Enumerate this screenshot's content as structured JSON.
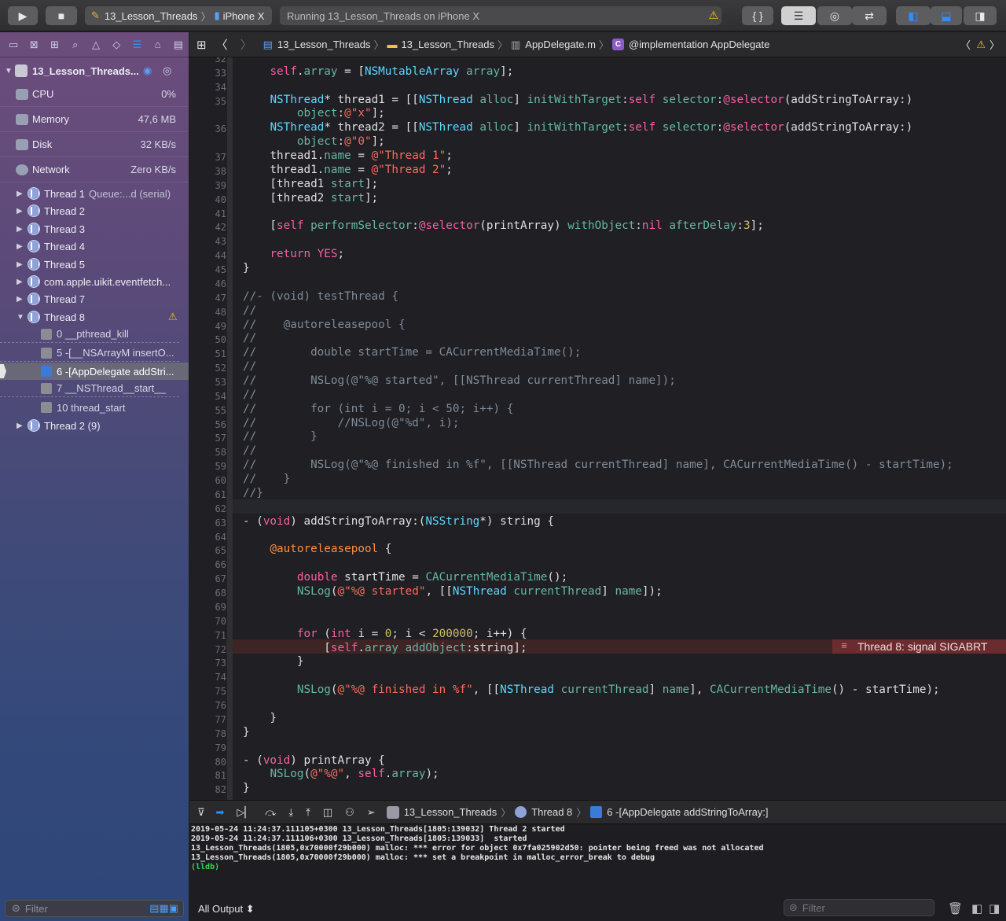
{
  "toolbar": {
    "run_icon": "play-icon",
    "stop_icon": "stop-icon",
    "scheme": "13_Lesson_Threads",
    "device": "iPhone X",
    "status": "Running 13_Lesson_Threads on iPhone X",
    "warn_glyph": "⚠"
  },
  "sidebar": {
    "process": "13_Lesson_Threads...",
    "gauges": [
      {
        "label": "CPU",
        "value": "0%"
      },
      {
        "label": "Memory",
        "value": "47,6 MB"
      },
      {
        "label": "Disk",
        "value": "32 KB/s"
      },
      {
        "label": "Network",
        "value": "Zero KB/s"
      }
    ],
    "threads": [
      {
        "name": "Thread 1",
        "detail": "Queue:...d (serial)"
      },
      {
        "name": "Thread 2",
        "detail": ""
      },
      {
        "name": "Thread 3",
        "detail": ""
      },
      {
        "name": "Thread 4",
        "detail": ""
      },
      {
        "name": "Thread 5",
        "detail": ""
      },
      {
        "name": "com.apple.uikit.eventfetch...",
        "detail": ""
      },
      {
        "name": "Thread 7",
        "detail": ""
      },
      {
        "name": "Thread 8",
        "detail": ""
      }
    ],
    "frames": [
      "0 __pthread_kill",
      "5 -[__NSArrayM insertO...",
      "6 -[AppDelegate addStri...",
      "7 __NSThread__start__",
      "10 thread_start"
    ],
    "last_thread": "Thread 2 (9)",
    "filter_placeholder": "Filter"
  },
  "jumpbar": {
    "project": "13_Lesson_Threads",
    "folder": "13_Lesson_Threads",
    "file": "AppDelegate.m",
    "symbol": "@implementation AppDelegate"
  },
  "code": {
    "first_line": 32,
    "error_badge": "Thread 8: signal SIGABRT"
  },
  "debug": {
    "project": "13_Lesson_Threads",
    "thread": "Thread 8",
    "frame": "6 -[AppDelegate addStringToArray:]"
  },
  "console": {
    "lines": [
      "2019-05-24 11:24:37.111105+0300 13_Lesson_Threads[1805:139032] Thread 2 started",
      "2019-05-24 11:24:37.111106+0300 13_Lesson_Threads[1805:139033]  started",
      "13_Lesson_Threads(1805,0x70000f29b000) malloc: *** error for object 0x7fa025902d50: pointer being freed was not allocated",
      "13_Lesson_Threads(1805,0x70000f29b000) malloc: *** set a breakpoint in malloc_error_break to debug",
      "(lldb)"
    ],
    "output_selector": "All Output ⬍",
    "filter_placeholder": "Filter"
  },
  "colors": {
    "accent": "#2f8fff",
    "error": "#6b2c2f",
    "warning": "#f4c20d"
  }
}
